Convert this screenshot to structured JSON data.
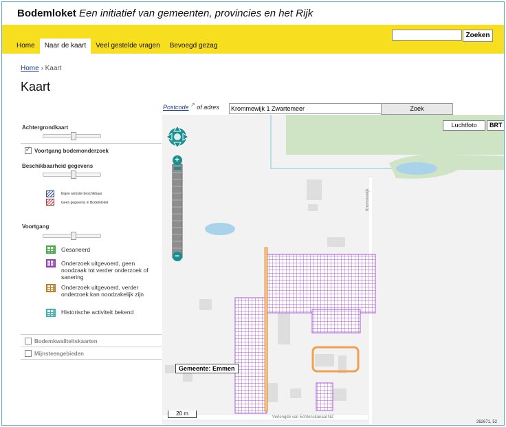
{
  "header": {
    "brand": "Bodemloket",
    "tagline": "Een initiatief van gemeenten, provincies en het Rijk",
    "search_placeholder": "",
    "search_button": "Zoeken"
  },
  "nav": [
    {
      "label": "Home",
      "active": false
    },
    {
      "label": "Naar de kaart",
      "active": true
    },
    {
      "label": "Veel gestelde vragen",
      "active": false
    },
    {
      "label": "Bevoegd gezag",
      "active": false
    }
  ],
  "breadcrumb": {
    "home": "Home",
    "separator": "›",
    "current": "Kaart"
  },
  "page_title": "Kaart",
  "address_search": {
    "postcode_link": "Postcode",
    "or_label": "of adres",
    "value": "Krommewijk 1 Zwartemeer",
    "button": "Zoek"
  },
  "sidebar": {
    "achtergrondkaart": "Achtergrondkaart",
    "voortgang_checkbox": "Voortgang bodemonderzoek",
    "beschikbaarheid": "Beschikbaarheid gegevens",
    "beschikbaarheid_legend": [
      "Eigen website beschikbaar",
      "Geen gegevens in Bodemloket"
    ],
    "voortgang": "Voortgang",
    "legend": [
      {
        "label": "Gesaneerd",
        "color": "#3cb13c"
      },
      {
        "label": "Onderzoek uitgevoerd, geen noodzaak tot verder onderzoek of sanering",
        "color": "#9b39c7"
      },
      {
        "label": "Onderzoek uitgevoerd, verder onderzoek kan noodzakelijk zijn",
        "color": "#c87a1f"
      },
      {
        "label": "Historische activiteit bekend",
        "color": "#39b8b8"
      }
    ],
    "bodemkwaliteit": "Bodemkwaliteitskaarten",
    "mijnsteen": "Mijnsteengebieden"
  },
  "map": {
    "luchtfoto_button": "Luchtfoto",
    "brt_button": "BRT",
    "gemeente_label": "Gemeente: Emmen",
    "scale_label": "20 m",
    "coordinate": "262671, 52",
    "road_krommewijk": "Krommewijk",
    "road_bottom": "Verlengde van Echtenskanaal NZ",
    "zoom_in": "+",
    "zoom_out": "−"
  },
  "colors": {
    "yellow": "#f7de1f",
    "purple": "#9b39c7",
    "orange": "#f0a050",
    "link": "#1c3b8f",
    "nav_control": "#1a8f8f"
  }
}
